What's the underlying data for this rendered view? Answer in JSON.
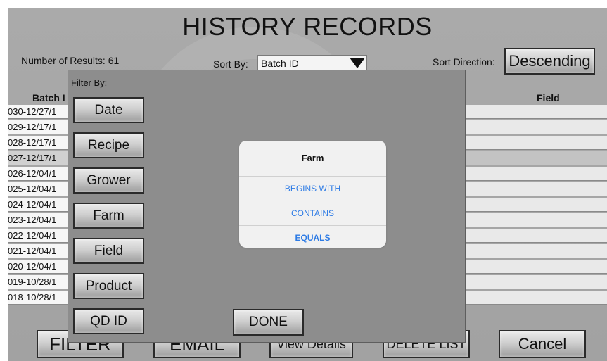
{
  "page": {
    "title": "HISTORY RECORDS",
    "results_label": "Number of Results: 61",
    "sort_by_label": "Sort By:",
    "sort_by_value": "Batch ID",
    "sort_direction_label": "Sort Direction:",
    "sort_direction_value": "Descending"
  },
  "table": {
    "columns": [
      "Batch I",
      "Field"
    ],
    "rows": [
      {
        "batch": "030-12/27/1",
        "selected": false
      },
      {
        "batch": "029-12/17/1",
        "selected": false
      },
      {
        "batch": "028-12/17/1",
        "selected": false
      },
      {
        "batch": "027-12/17/1",
        "selected": true
      },
      {
        "batch": "026-12/04/1",
        "selected": false
      },
      {
        "batch": "025-12/04/1",
        "selected": false
      },
      {
        "batch": "024-12/04/1",
        "selected": false
      },
      {
        "batch": "023-12/04/1",
        "selected": false
      },
      {
        "batch": "022-12/04/1",
        "selected": false
      },
      {
        "batch": "021-12/04/1",
        "selected": false
      },
      {
        "batch": "020-12/04/1",
        "selected": false
      },
      {
        "batch": "019-10/28/1",
        "selected": false
      },
      {
        "batch": "018-10/28/1",
        "selected": false
      }
    ]
  },
  "bottom_buttons": {
    "filter": "FILTER",
    "email": "EMAIL",
    "view_details": "View Details",
    "delete_list": "DELETE LIST",
    "cancel": "Cancel"
  },
  "filter_panel": {
    "label": "Filter By:",
    "buttons": [
      "Date",
      "Recipe",
      "Grower",
      "Farm",
      "Field",
      "Product",
      "QD ID"
    ],
    "done": "DONE"
  },
  "action_sheet": {
    "title": "Farm",
    "options": [
      "BEGINS WITH",
      "CONTAINS",
      "EQUALS"
    ]
  },
  "colors": {
    "background": "#a6a6a6",
    "panel": "#8d8d8d",
    "sheet_option": "#2d7be5",
    "row_cell": "#f6f6f6"
  }
}
